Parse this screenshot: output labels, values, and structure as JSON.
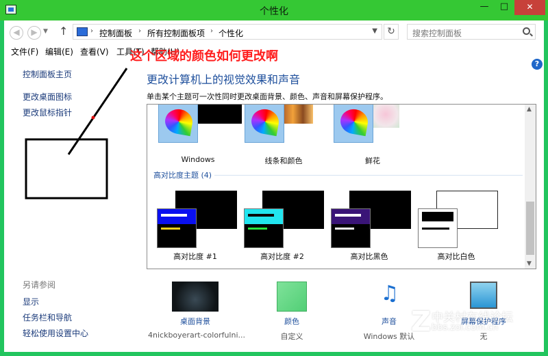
{
  "window": {
    "title": "个性化",
    "minimize": "—",
    "maximize": "□",
    "close": "✕"
  },
  "address": {
    "crumbs": [
      "控制面板",
      "所有控制面板项",
      "个性化"
    ],
    "search_placeholder": "搜索控制面板"
  },
  "menu": [
    "文件(F)",
    "编辑(E)",
    "查看(V)",
    "工具(T)",
    "帮助(H)"
  ],
  "sidebar": {
    "links": [
      "控制面板主页",
      "更改桌面图标",
      "更改鼠标指针"
    ],
    "see_also_heading": "另请参阅",
    "see_also": [
      "显示",
      "任务栏和导航",
      "轻松使用设置中心"
    ]
  },
  "main": {
    "title": "更改计算机上的视觉效果和声音",
    "description": "单击某个主题可一次性同时更改桌面背景、颜色、声音和屏幕保护程序。",
    "themes": [
      "Windows",
      "线条和颜色",
      "鲜花"
    ],
    "high_contrast_heading": "高对比度主题 (4)",
    "high_contrast_themes": [
      "高对比度 #1",
      "高对比度 #2",
      "高对比黑色",
      "高对比白色"
    ]
  },
  "bottom": [
    {
      "title": "桌面背景",
      "subtitle": "4nickboyerart-colorfulni..."
    },
    {
      "title": "颜色",
      "subtitle": "自定义"
    },
    {
      "title": "声音",
      "subtitle": "Windows 默认"
    },
    {
      "title": "屏幕保护程序",
      "subtitle": "无"
    }
  ],
  "annotation": {
    "text": "这个区域的颜色如何更改啊"
  },
  "watermark": {
    "line1": "中关村在线论坛",
    "line2": "bbs.zol.com.cn"
  },
  "colors": {
    "frame": "#35c834",
    "link": "#1e4f9c",
    "annotation": "#ff1e1e",
    "close": "#c7413a"
  },
  "icons": [
    "back-icon",
    "forward-icon",
    "up-icon",
    "refresh-icon",
    "search-icon",
    "help-icon",
    "color-wheel-icon",
    "music-notes-icon",
    "screensaver-icon"
  ]
}
